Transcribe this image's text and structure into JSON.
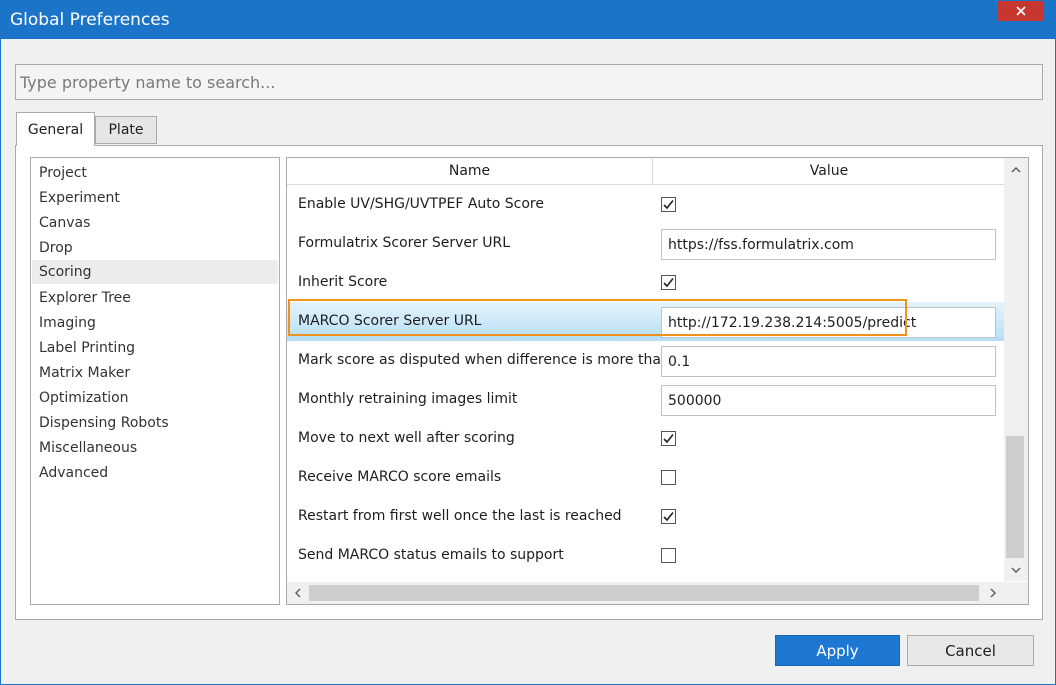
{
  "window": {
    "title": "Global Preferences"
  },
  "search": {
    "placeholder": "Type property name to search..."
  },
  "tabs": [
    {
      "label": "General",
      "active": true
    },
    {
      "label": "Plate",
      "active": false
    }
  ],
  "categories": [
    {
      "label": "Project"
    },
    {
      "label": "Experiment"
    },
    {
      "label": "Canvas"
    },
    {
      "label": "Drop"
    },
    {
      "label": "Scoring",
      "selected": true
    },
    {
      "label": "Explorer Tree"
    },
    {
      "label": "Imaging"
    },
    {
      "label": "Label Printing"
    },
    {
      "label": "Matrix Maker"
    },
    {
      "label": "Optimization"
    },
    {
      "label": "Dispensing Robots"
    },
    {
      "label": "Miscellaneous"
    },
    {
      "label": "Advanced"
    }
  ],
  "grid": {
    "columns": {
      "name": "Name",
      "value": "Value"
    },
    "rows": [
      {
        "name": "Enable UV/SHG/UVTPEF Auto Score",
        "type": "checkbox",
        "checked": true
      },
      {
        "name": "Formulatrix Scorer Server URL",
        "type": "text",
        "value": "https://fss.formulatrix.com"
      },
      {
        "name": "Inherit Score",
        "type": "checkbox",
        "checked": true
      },
      {
        "name": "MARCO Scorer Server URL",
        "type": "text",
        "value": "http://172.19.238.214:5005/predict",
        "selected": true
      },
      {
        "name": "Mark score as disputed when difference is more than",
        "type": "text",
        "value": "0.1"
      },
      {
        "name": "Monthly retraining images limit",
        "type": "text",
        "value": "500000"
      },
      {
        "name": "Move to next well after scoring",
        "type": "checkbox",
        "checked": true
      },
      {
        "name": "Receive MARCO score emails",
        "type": "checkbox",
        "checked": false
      },
      {
        "name": "Restart from first well once the last is reached",
        "type": "checkbox",
        "checked": true
      },
      {
        "name": "Send MARCO status emails to support",
        "type": "checkbox",
        "checked": false
      }
    ]
  },
  "buttons": {
    "apply": "Apply",
    "cancel": "Cancel"
  },
  "colors": {
    "titlebar": "#1c74c9",
    "close": "#c7372f",
    "highlight": "#f0921e",
    "apply": "#1e78d2"
  },
  "icons": {
    "close": "close-icon",
    "check": "checkmark-icon",
    "scroll_up": "chevron-up-icon",
    "scroll_down": "chevron-down-icon",
    "scroll_left": "chevron-left-icon",
    "scroll_right": "chevron-right-icon"
  }
}
